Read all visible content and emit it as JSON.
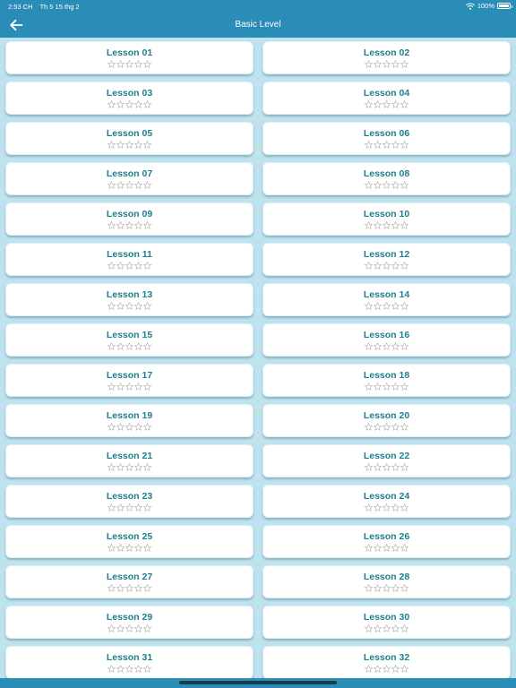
{
  "status_bar": {
    "time": "2:53 CH",
    "date": "Th 5 15 thg 2",
    "battery": "100%",
    "wifi_icon": "wifi-icon",
    "battery_icon": "battery-full-icon"
  },
  "nav": {
    "title": "Basic Level",
    "back_icon": "arrow-left-icon"
  },
  "colors": {
    "header": "#2a8db7",
    "background": "#bfe3ee",
    "card": "#ffffff",
    "lesson_text": "#1c7f8c",
    "star_outline": "#b8b8b8"
  },
  "star_count": 5,
  "lessons": [
    {
      "title": "Lesson 01",
      "stars_earned": 0
    },
    {
      "title": "Lesson 02",
      "stars_earned": 0
    },
    {
      "title": "Lesson 03",
      "stars_earned": 0
    },
    {
      "title": "Lesson 04",
      "stars_earned": 0
    },
    {
      "title": "Lesson 05",
      "stars_earned": 0
    },
    {
      "title": "Lesson 06",
      "stars_earned": 0
    },
    {
      "title": "Lesson 07",
      "stars_earned": 0
    },
    {
      "title": "Lesson 08",
      "stars_earned": 0
    },
    {
      "title": "Lesson 09",
      "stars_earned": 0
    },
    {
      "title": "Lesson 10",
      "stars_earned": 0
    },
    {
      "title": "Lesson 11",
      "stars_earned": 0
    },
    {
      "title": "Lesson 12",
      "stars_earned": 0
    },
    {
      "title": "Lesson 13",
      "stars_earned": 0
    },
    {
      "title": "Lesson 14",
      "stars_earned": 0
    },
    {
      "title": "Lesson 15",
      "stars_earned": 0
    },
    {
      "title": "Lesson 16",
      "stars_earned": 0
    },
    {
      "title": "Lesson 17",
      "stars_earned": 0
    },
    {
      "title": "Lesson 18",
      "stars_earned": 0
    },
    {
      "title": "Lesson 19",
      "stars_earned": 0
    },
    {
      "title": "Lesson 20",
      "stars_earned": 0
    },
    {
      "title": "Lesson 21",
      "stars_earned": 0
    },
    {
      "title": "Lesson 22",
      "stars_earned": 0
    },
    {
      "title": "Lesson 23",
      "stars_earned": 0
    },
    {
      "title": "Lesson 24",
      "stars_earned": 0
    },
    {
      "title": "Lesson 25",
      "stars_earned": 0
    },
    {
      "title": "Lesson 26",
      "stars_earned": 0
    },
    {
      "title": "Lesson 27",
      "stars_earned": 0
    },
    {
      "title": "Lesson 28",
      "stars_earned": 0
    },
    {
      "title": "Lesson 29",
      "stars_earned": 0
    },
    {
      "title": "Lesson 30",
      "stars_earned": 0
    },
    {
      "title": "Lesson 31",
      "stars_earned": 0
    },
    {
      "title": "Lesson 32",
      "stars_earned": 0
    }
  ]
}
